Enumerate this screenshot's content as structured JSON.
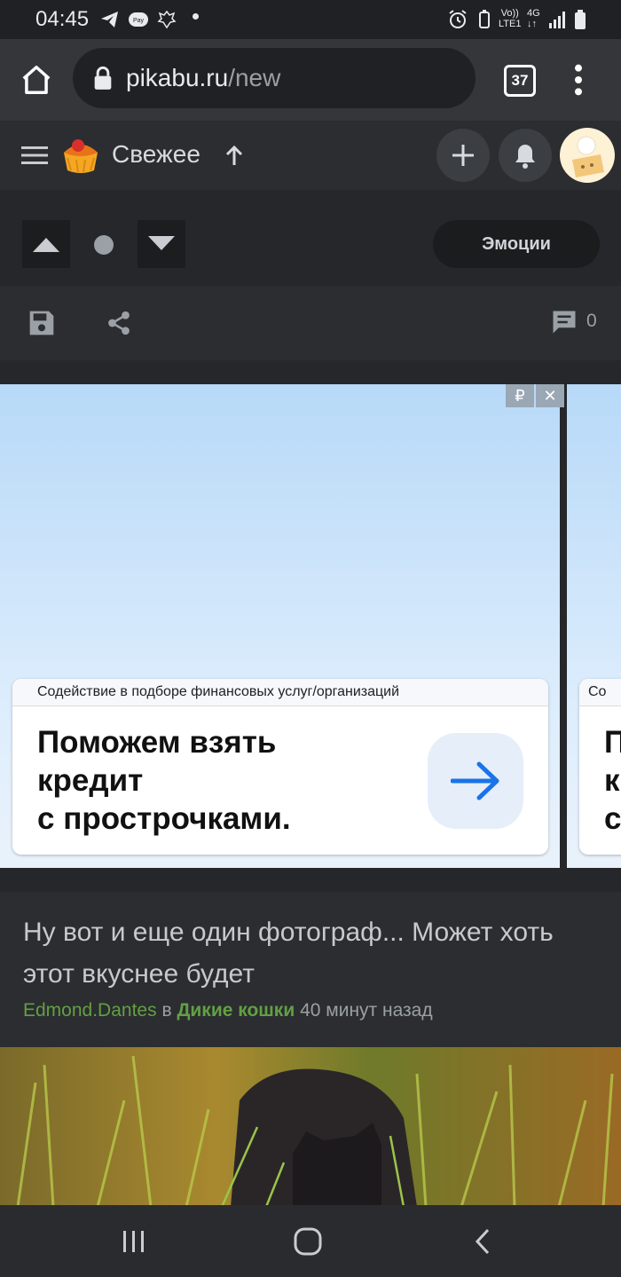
{
  "status_bar": {
    "time": "04:45",
    "network_label_top": "Vo))",
    "network_label_bottom": "LTE1",
    "network_type": "4G"
  },
  "browser": {
    "url_domain": "pikabu.ru",
    "url_path": "/new",
    "tab_count": "37"
  },
  "header": {
    "title": "Свежее"
  },
  "post_controls": {
    "emotions_label": "Эмоции",
    "comment_count": "0"
  },
  "ad": {
    "badge_currency": "₽",
    "badge_close": "✕",
    "card_header": "Содействие в подборе финансовых услуг/организаций",
    "card_text": "Поможем взять\nкредит\nс прострочками.",
    "second_card_header": "Со",
    "second_card_text": "П\nк\nс"
  },
  "post": {
    "title": "Ну вот и еще один фотограф... Может хоть этот вкуснее будет",
    "author": "Edmond.Dantes",
    "preposition": "в",
    "community": "Дикие кошки",
    "time_ago": "40 минут назад"
  },
  "colors": {
    "accent_green": "#62a043",
    "ad_arrow": "#1a73e8"
  }
}
